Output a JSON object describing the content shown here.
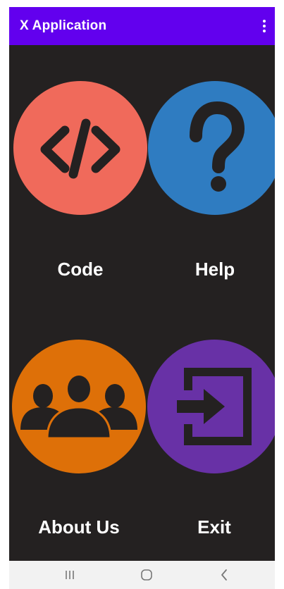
{
  "app_bar": {
    "title": "X Application",
    "background": "#6200ee",
    "overflow_icon": "more-vert-icon"
  },
  "screen_background": "#242121",
  "tiles": [
    {
      "label": "Code",
      "color": "#f06a5b",
      "icon": "code-icon"
    },
    {
      "label": "Help",
      "color": "#2f7cc1",
      "icon": "question-icon"
    },
    {
      "label": "About Us",
      "color": "#de7008",
      "icon": "group-icon"
    },
    {
      "label": "Exit",
      "color": "#6831a6",
      "icon": "exit-icon"
    }
  ],
  "nav_bar": {
    "buttons": [
      "recents-icon",
      "home-icon",
      "back-icon"
    ]
  }
}
